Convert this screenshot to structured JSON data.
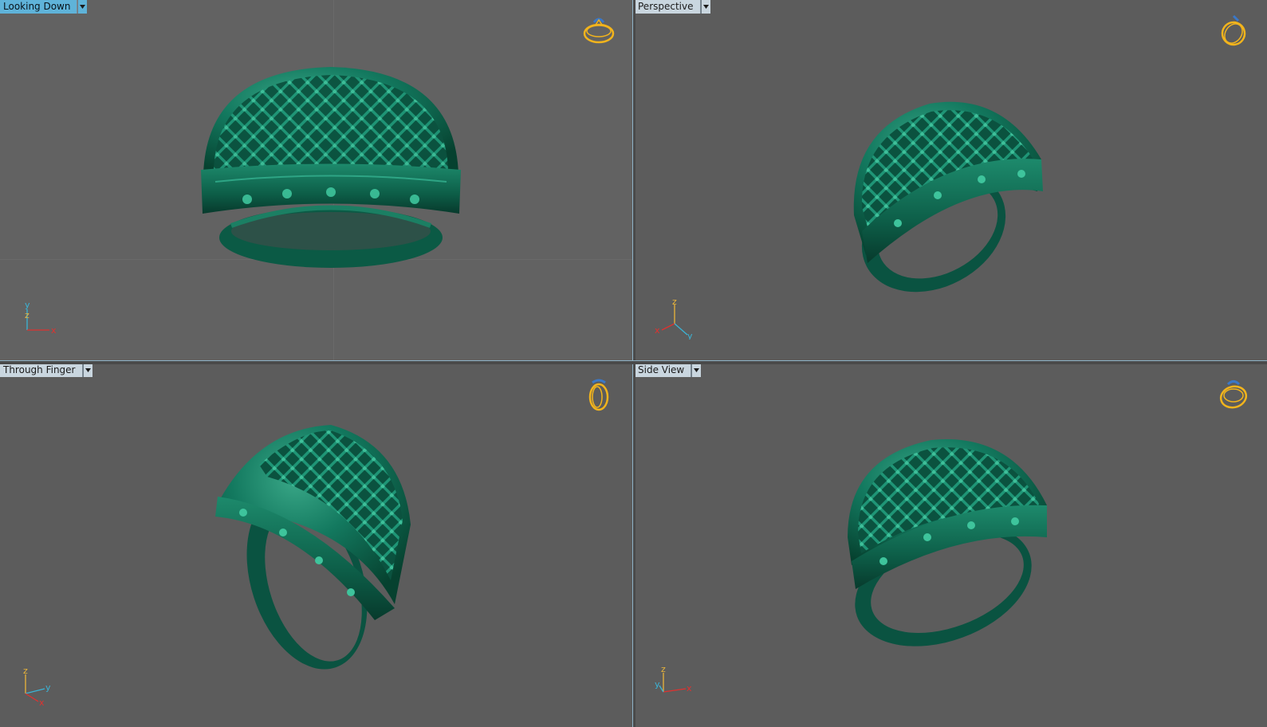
{
  "viewports": {
    "top_left": {
      "label": "Looking Down",
      "active": true,
      "axes": [
        "y",
        "z",
        "x"
      ]
    },
    "top_right": {
      "label": "Perspective",
      "active": false,
      "axes": [
        "z",
        "x",
        "y"
      ]
    },
    "bottom_left": {
      "label": "Through Finger",
      "active": false,
      "axes": [
        "z",
        "y",
        "x"
      ]
    },
    "bottom_right": {
      "label": "Side View",
      "active": false,
      "axes": [
        "z",
        "y",
        "x"
      ]
    }
  },
  "icons": {
    "dropdown": "chevron-down-icon",
    "view_cube": "ring-view-cube-icon",
    "axis_gizmo": "axis-gizmo-icon",
    "model": "filigree-ring-model"
  },
  "colors": {
    "viewport_bg": "#5c5c5c",
    "active_tab": "#5fb3d9",
    "inactive_tab": "#c9d6df",
    "model_green": "#0f6b55",
    "view_cube_gold": "#f2b41c",
    "axis_x": "#e0312f",
    "axis_y": "#3bb4d6",
    "axis_z": "#e9b43a"
  }
}
